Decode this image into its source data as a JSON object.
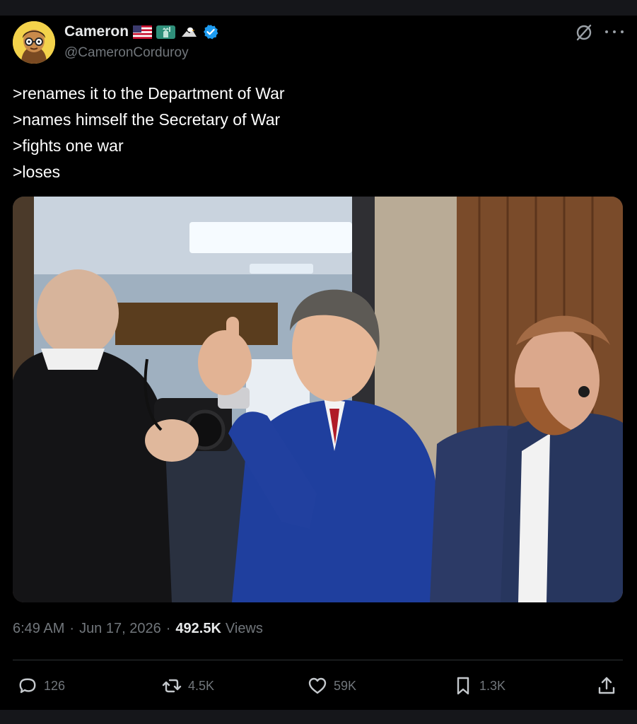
{
  "post": {
    "author": {
      "display_name": "Cameron",
      "handle": "@CameronCorduroy",
      "badges": [
        "us-flag-icon",
        "statue-of-liberty-icon",
        "eagle-icon",
        "verified-badge-icon"
      ]
    },
    "text_lines": [
      ">renames it to the Department of War",
      ">names himself the Secretary of War",
      ">fights one war",
      ">loses"
    ],
    "timestamp": "6:49 AM",
    "date": "Jun 17, 2026",
    "separator": "·",
    "views_count": "492.5K",
    "views_label": "Views"
  },
  "actions": {
    "replies": "126",
    "reposts": "4.5K",
    "likes": "59K",
    "bookmarks": "1.3K"
  },
  "colors": {
    "background": "#000000",
    "text_primary": "#e7e9ea",
    "text_secondary": "#71767b",
    "verified_blue": "#1d9bf0",
    "divider": "#2f3336"
  }
}
